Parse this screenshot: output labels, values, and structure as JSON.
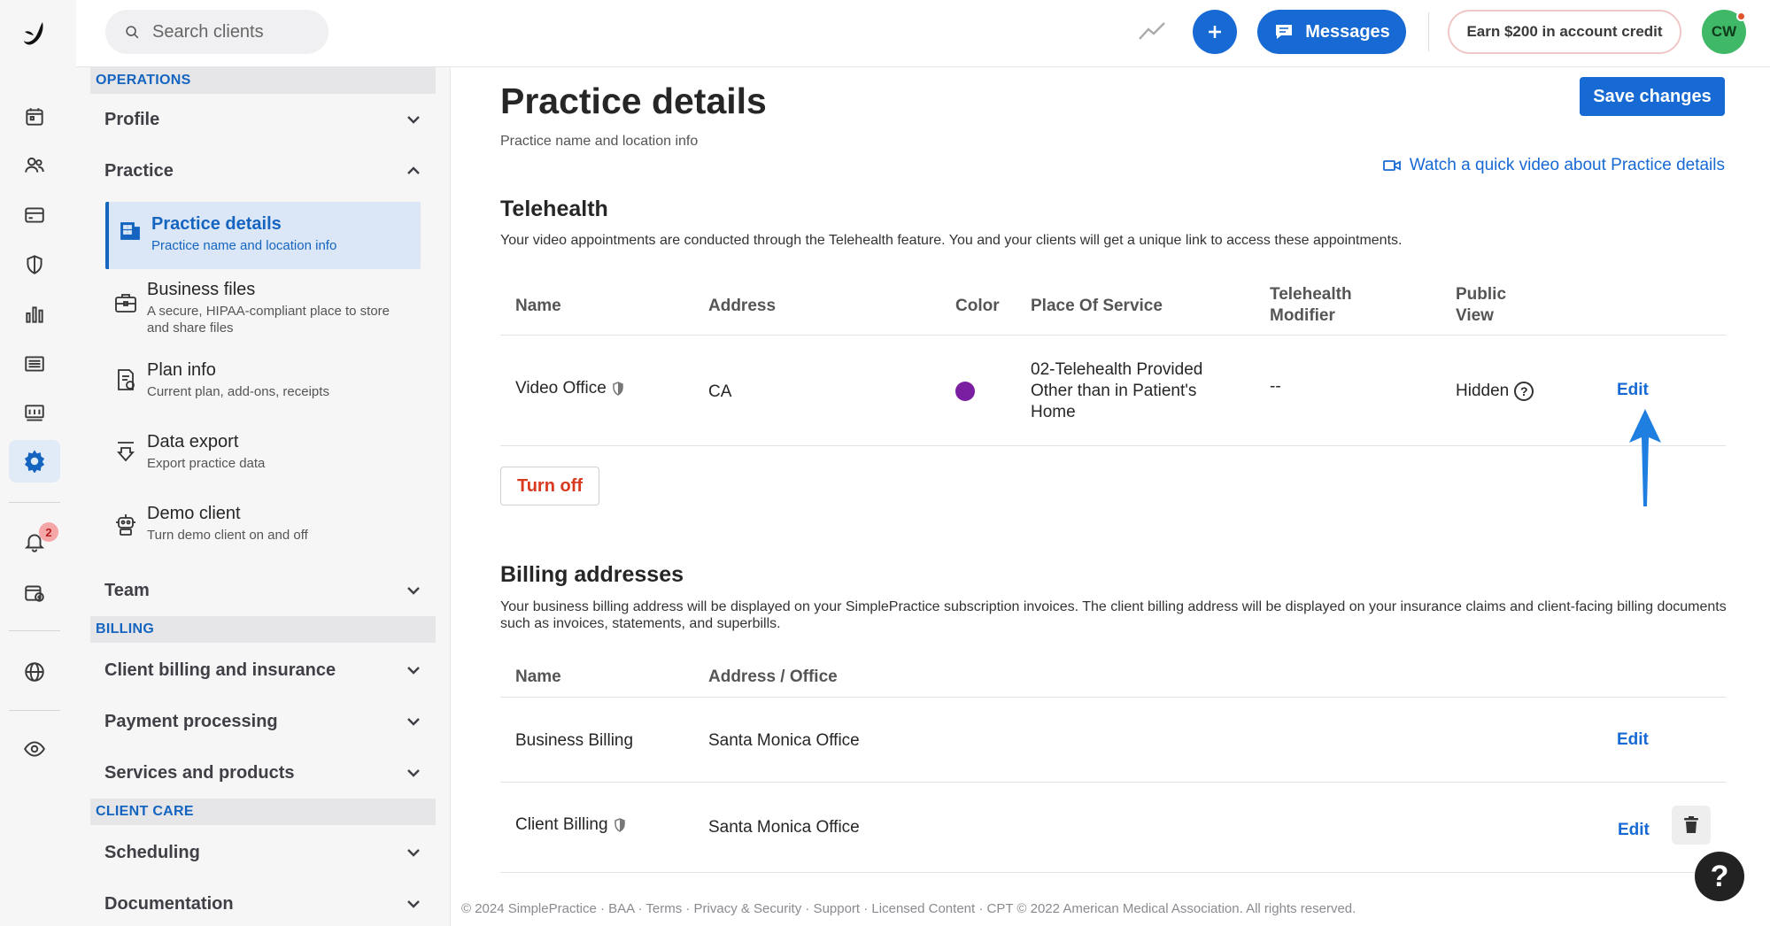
{
  "search": {
    "placeholder": "Search clients"
  },
  "topbar": {
    "messages_label": "Messages",
    "earn_label": "Earn $200 in account credit",
    "avatar_initials": "CW"
  },
  "rail": {
    "notifications_count": "2"
  },
  "nav": {
    "groups": {
      "operations": "OPERATIONS",
      "billing": "BILLING",
      "client_care": "CLIENT CARE"
    },
    "profile": "Profile",
    "practice": "Practice",
    "practice_items": [
      {
        "title": "Practice details",
        "desc": "Practice name and location info",
        "icon": "building-icon"
      },
      {
        "title": "Business files",
        "desc": "A secure, HIPAA-compliant place to store and share files",
        "icon": "briefcase-icon"
      },
      {
        "title": "Plan info",
        "desc": "Current plan, add-ons, receipts",
        "icon": "receipt-icon"
      },
      {
        "title": "Data export",
        "desc": "Export practice data",
        "icon": "download-icon"
      },
      {
        "title": "Demo client",
        "desc": "Turn demo client on and off",
        "icon": "robot-icon"
      }
    ],
    "team": "Team",
    "client_billing": "Client billing and insurance",
    "payment_processing": "Payment processing",
    "services_products": "Services and products",
    "scheduling": "Scheduling",
    "documentation": "Documentation"
  },
  "page": {
    "title": "Practice details",
    "subtitle": "Practice name and location info",
    "save_label": "Save changes",
    "video_link": "Watch a quick video about Practice details"
  },
  "telehealth": {
    "title": "Telehealth",
    "desc": "Your video appointments are conducted through the Telehealth feature. You and your clients will get a unique link to access these appointments.",
    "headers": [
      "Name",
      "Address",
      "Color",
      "Place Of Service",
      "Telehealth Modifier",
      "Public View"
    ],
    "row": {
      "name": "Video Office",
      "address": "CA",
      "color": "#7b1fa2",
      "place_of_service": "02-Telehealth Provided Other than in Patient's Home",
      "modifier": "--",
      "public_view": "Hidden",
      "edit": "Edit"
    },
    "turn_off": "Turn off"
  },
  "billing": {
    "title": "Billing addresses",
    "desc": "Your business billing address will be displayed on your SimplePractice subscription invoices. The client billing address will be displayed on your insurance claims and client-facing billing documents such as invoices, statements, and superbills.",
    "headers": [
      "Name",
      "Address / Office"
    ],
    "rows": [
      {
        "name": "Business Billing",
        "office": "Santa Monica Office",
        "edit": "Edit"
      },
      {
        "name": "Client Billing",
        "office": "Santa Monica Office",
        "edit": "Edit"
      }
    ]
  },
  "footer": "© 2024 SimplePractice · BAA · Terms · Privacy & Security · Support · Licensed Content · CPT © 2022 American Medical Association. All rights reserved.",
  "help_fab": "?",
  "colors": {
    "accent": "#1769d3",
    "danger": "#d93a1f",
    "avatar": "#3fb868"
  }
}
